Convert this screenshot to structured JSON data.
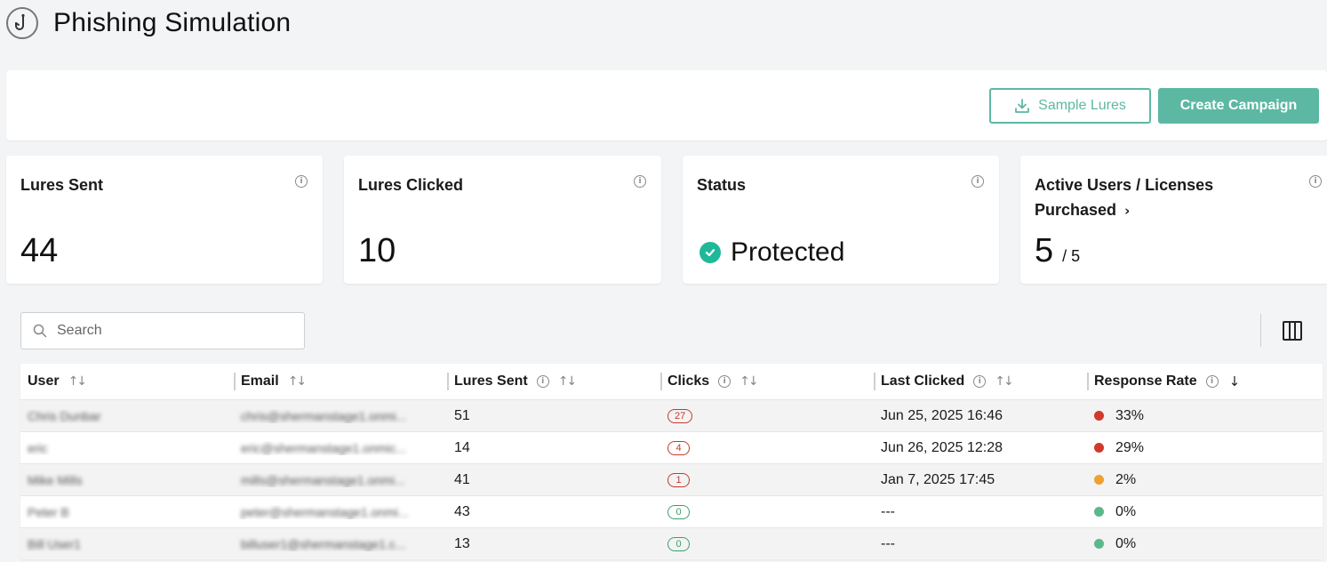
{
  "page": {
    "title": "Phishing Simulation"
  },
  "actions": {
    "sample_lures": "Sample Lures",
    "create_campaign": "Create Campaign"
  },
  "stats": {
    "lures_sent": {
      "label": "Lures Sent",
      "value": "44"
    },
    "lures_clicked": {
      "label": "Lures Clicked",
      "value": "10"
    },
    "status": {
      "label": "Status",
      "value": "Protected"
    },
    "active_users": {
      "label_line1": "Active Users / Licenses",
      "label_line2": "Purchased",
      "value": "5",
      "total": "/ 5"
    }
  },
  "search": {
    "placeholder": "Search"
  },
  "table": {
    "headers": {
      "user": "User",
      "email": "Email",
      "lures_sent": "Lures Sent",
      "clicks": "Clicks",
      "last_clicked": "Last Clicked",
      "response_rate": "Response Rate"
    },
    "rows": [
      {
        "user": "Chris Dunbar",
        "email": "chris@shermanstage1.onmi...",
        "lures_sent": "51",
        "clicks": "27",
        "clicks_status": "red",
        "last_clicked": "Jun 25, 2025 16:46",
        "response_rate": "33%",
        "rate_color": "#d03a2b"
      },
      {
        "user": "eric",
        "email": "eric@shermanstage1.onmic...",
        "lures_sent": "14",
        "clicks": "4",
        "clicks_status": "red",
        "last_clicked": "Jun 26, 2025 12:28",
        "response_rate": "29%",
        "rate_color": "#d03a2b"
      },
      {
        "user": "Mike Mills",
        "email": "mills@shermanstage1.onmi...",
        "lures_sent": "41",
        "clicks": "1",
        "clicks_status": "red",
        "last_clicked": "Jan 7, 2025 17:45",
        "response_rate": "2%",
        "rate_color": "#f0a030"
      },
      {
        "user": "Peter B",
        "email": "peter@shermanstage1.onmi...",
        "lures_sent": "43",
        "clicks": "0",
        "clicks_status": "green",
        "last_clicked": "---",
        "response_rate": "0%",
        "rate_color": "#5cb88a"
      },
      {
        "user": "Bill User1",
        "email": "billuser1@shermanstage1.c...",
        "lures_sent": "13",
        "clicks": "0",
        "clicks_status": "green",
        "last_clicked": "---",
        "response_rate": "0%",
        "rate_color": "#5cb88a"
      }
    ]
  },
  "icons": {
    "header": "fishhook-icon",
    "download": "download-icon",
    "info": "info-icon",
    "status": "check-circle-icon",
    "search": "search-icon",
    "columns": "columns-icon",
    "sort": "sort-icon",
    "sort_desc": "sort-desc-icon"
  },
  "colors": {
    "accent": "#5cb8a3",
    "status_green": "#1fb99a"
  }
}
